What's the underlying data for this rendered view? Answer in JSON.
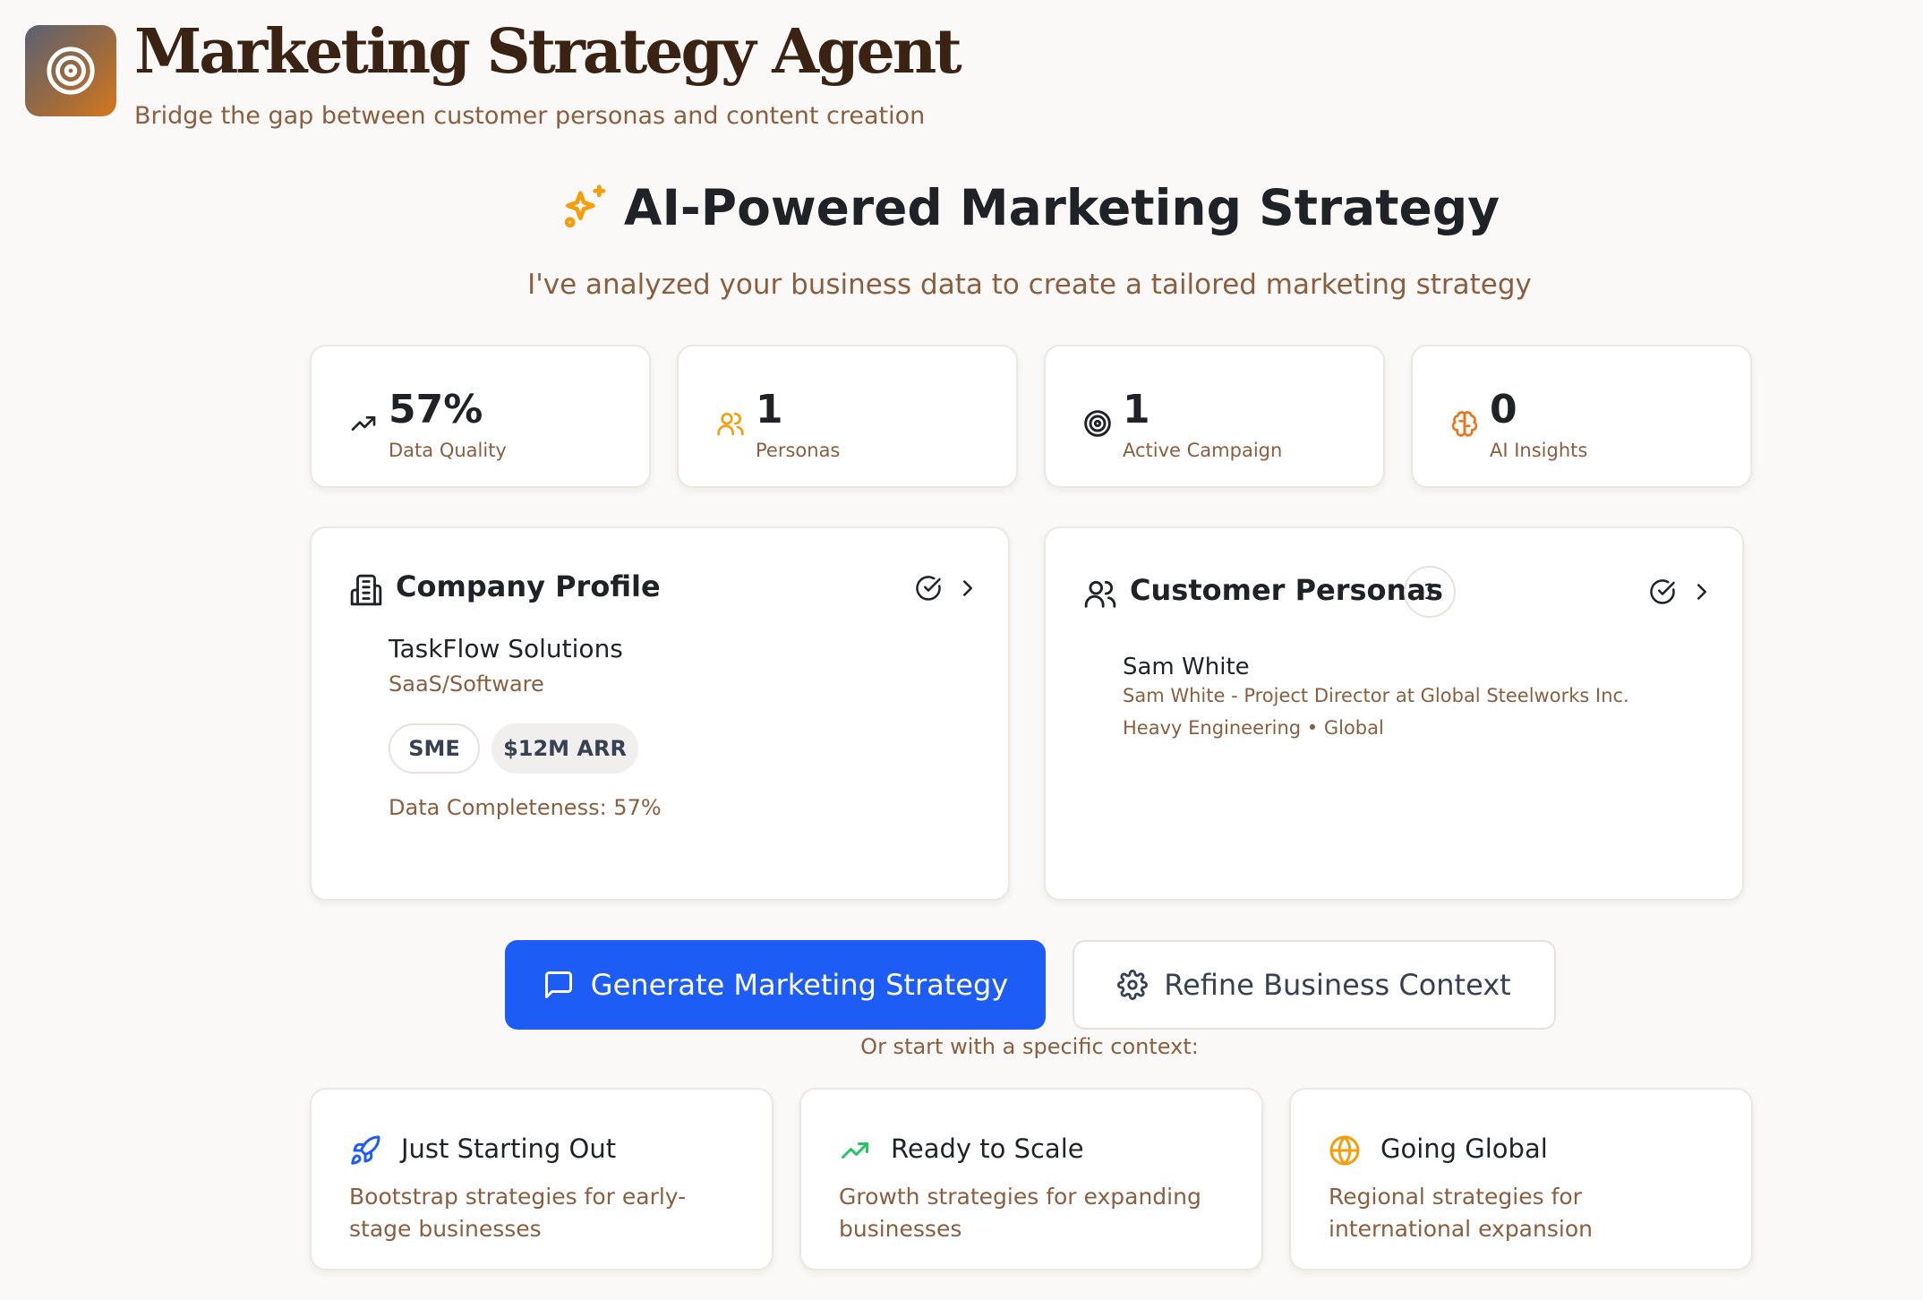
{
  "app": {
    "title": "Marketing Strategy Agent",
    "subtitle": "Bridge the gap between customer personas and content creation",
    "logo_icon": "target-icon"
  },
  "hero": {
    "title": "AI-Powered Marketing Strategy",
    "subtitle": "I've analyzed your business data to create a tailored marketing strategy",
    "icon": "sparkles-icon"
  },
  "stats": [
    {
      "icon": "trending-up-icon",
      "value": "57%",
      "label": "Data Quality"
    },
    {
      "icon": "users-icon",
      "value": "1",
      "label": "Personas"
    },
    {
      "icon": "target-icon",
      "value": "1",
      "label": "Active Campaign"
    },
    {
      "icon": "brain-icon",
      "value": "0",
      "label": "AI Insights"
    }
  ],
  "company_profile": {
    "title": "Company Profile",
    "name": "TaskFlow Solutions",
    "industry": "SaaS/Software",
    "tags": [
      "SME",
      "$12M ARR"
    ],
    "completeness": "Data Completeness: 57%"
  },
  "customer_personas": {
    "title": "Customer Personas",
    "count": "1",
    "persona": {
      "name": "Sam White",
      "description": "Sam White - Project Director at Global Steelworks Inc.",
      "meta": "Heavy Engineering • Global"
    }
  },
  "actions": {
    "primary": "Generate Marketing Strategy",
    "secondary": "Refine Business Context",
    "or_text": "Or start with a specific context:"
  },
  "contexts": [
    {
      "icon": "rocket-icon",
      "title": "Just Starting Out",
      "description": "Bootstrap strategies for early-stage businesses"
    },
    {
      "icon": "trending-up-icon",
      "title": "Ready to Scale",
      "description": "Growth strategies for expanding businesses"
    },
    {
      "icon": "globe-icon",
      "title": "Going Global",
      "description": "Regional strategies for international expansion"
    }
  ],
  "colors": {
    "accent": "#1d5cf5",
    "brand_brown": "#3b2314",
    "muted_text": "#8a5e3f",
    "orange": "#f59e0b",
    "green": "#22c55e"
  }
}
